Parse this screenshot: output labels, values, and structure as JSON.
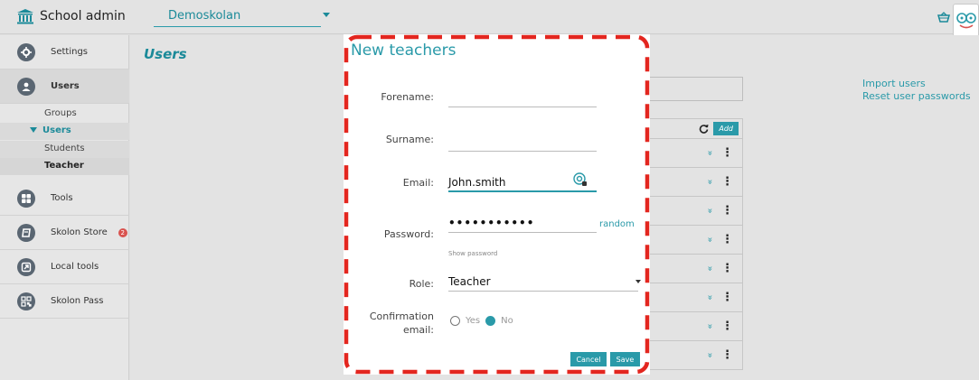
{
  "header": {
    "app_title": "School admin",
    "school_name": "Demoskolan"
  },
  "sidebar": {
    "items": [
      {
        "label": "Settings",
        "icon": "gear-icon"
      },
      {
        "label": "Users",
        "icon": "user-icon"
      },
      {
        "label": "Tools",
        "icon": "grid-icon"
      },
      {
        "label": "Skolon Store",
        "icon": "bag-icon",
        "badge": "2"
      },
      {
        "label": "Local tools",
        "icon": "external-link-icon"
      },
      {
        "label": "Skolon Pass",
        "icon": "qr-icon"
      }
    ],
    "sub_items": {
      "groups": "Groups",
      "users": "Users",
      "students": "Students",
      "teacher": "Teacher"
    }
  },
  "main": {
    "title": "Users",
    "links": {
      "import": "Import users",
      "reset": "Reset user passwords"
    },
    "table": {
      "add_label": "Add",
      "row_count": 8
    }
  },
  "modal": {
    "title": "New teachers",
    "fields": {
      "forename_label": "Forename:",
      "forename_value": "",
      "surname_label": "Surname:",
      "surname_value": "",
      "email_label": "Email:",
      "email_value": "John.smith",
      "password_label": "Password:",
      "password_value": "•••••••••••",
      "random_label": "random",
      "show_password_label": "Show password",
      "role_label": "Role:",
      "role_value": "Teacher",
      "confirmation_label_1": "Confirmation",
      "confirmation_label_2": "email:",
      "yes_label": "Yes",
      "no_label": "No"
    },
    "buttons": {
      "cancel": "Cancel",
      "save": "Save"
    }
  },
  "colors": {
    "accent": "#2a9aa9",
    "highlight_dash": "#e3261f",
    "badge": "#d9534f"
  }
}
